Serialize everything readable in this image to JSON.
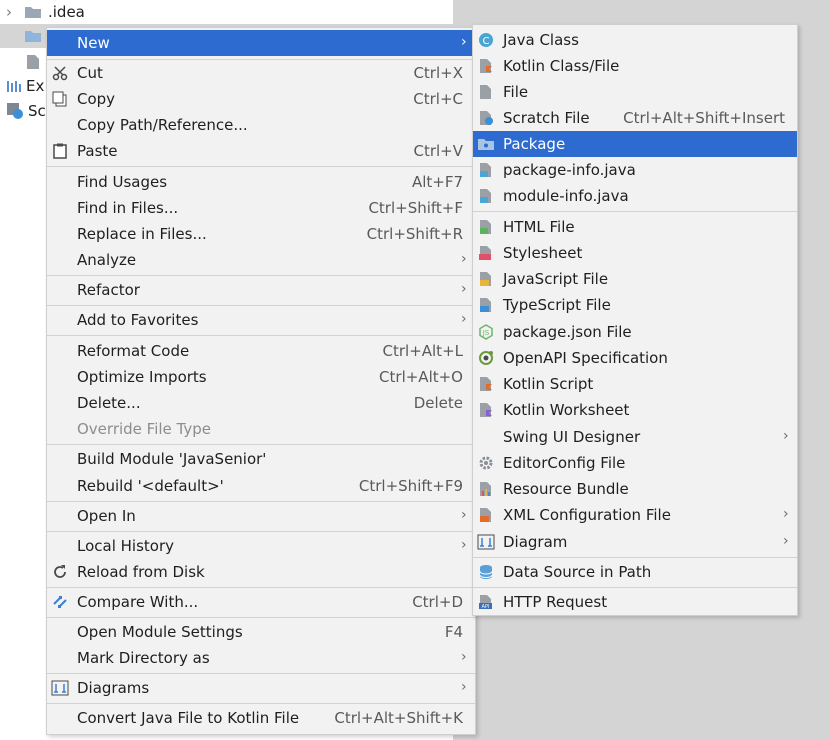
{
  "tree": {
    "rows": [
      ".idea",
      "",
      "Ex",
      "Sc"
    ]
  },
  "main_menu": {
    "items": [
      {
        "label": "New",
        "shortcut": "",
        "submenu": true
      },
      {
        "label": "Cut",
        "shortcut": "Ctrl+X",
        "icon": "scissors-icon"
      },
      {
        "label": "Copy",
        "shortcut": "Ctrl+C",
        "icon": "copy-icon"
      },
      {
        "label": "Copy Path/Reference...",
        "shortcut": ""
      },
      {
        "label": "Paste",
        "shortcut": "Ctrl+V",
        "icon": "clipboard-icon"
      },
      {
        "label": "Find Usages",
        "shortcut": "Alt+F7"
      },
      {
        "label": "Find in Files...",
        "shortcut": "Ctrl+Shift+F"
      },
      {
        "label": "Replace in Files...",
        "shortcut": "Ctrl+Shift+R"
      },
      {
        "label": "Analyze",
        "shortcut": "",
        "submenu": true
      },
      {
        "label": "Refactor",
        "shortcut": "",
        "submenu": true
      },
      {
        "label": "Add to Favorites",
        "shortcut": "",
        "submenu": true
      },
      {
        "label": "Reformat Code",
        "shortcut": "Ctrl+Alt+L"
      },
      {
        "label": "Optimize Imports",
        "shortcut": "Ctrl+Alt+O"
      },
      {
        "label": "Delete...",
        "shortcut": "Delete"
      },
      {
        "label": "Override File Type",
        "shortcut": "",
        "disabled": true
      },
      {
        "label": "Build Module 'JavaSenior'",
        "shortcut": ""
      },
      {
        "label": "Rebuild '<default>'",
        "shortcut": "Ctrl+Shift+F9"
      },
      {
        "label": "Open In",
        "shortcut": "",
        "submenu": true
      },
      {
        "label": "Local History",
        "shortcut": "",
        "submenu": true
      },
      {
        "label": "Reload from Disk",
        "shortcut": "",
        "icon": "reload-icon"
      },
      {
        "label": "Compare With...",
        "shortcut": "Ctrl+D",
        "icon": "compare-icon"
      },
      {
        "label": "Open Module Settings",
        "shortcut": "F4"
      },
      {
        "label": "Mark Directory as",
        "shortcut": "",
        "submenu": true
      },
      {
        "label": "Diagrams",
        "shortcut": "",
        "submenu": true,
        "icon": "diagram-icon"
      },
      {
        "label": "Convert Java File to Kotlin File",
        "shortcut": "Ctrl+Alt+Shift+K"
      }
    ]
  },
  "new_menu": {
    "items": [
      {
        "label": "Java Class",
        "shortcut": "",
        "icon": "java-class-icon"
      },
      {
        "label": "Kotlin Class/File",
        "shortcut": "",
        "icon": "kotlin-file-icon"
      },
      {
        "label": "File",
        "shortcut": "",
        "icon": "file-icon"
      },
      {
        "label": "Scratch File",
        "shortcut": "Ctrl+Alt+Shift+Insert",
        "icon": "scratch-file-icon"
      },
      {
        "label": "Package",
        "shortcut": "",
        "icon": "package-folder-icon"
      },
      {
        "label": "package-info.java",
        "shortcut": "",
        "icon": "java-file-icon"
      },
      {
        "label": "module-info.java",
        "shortcut": "",
        "icon": "java-file-icon"
      },
      {
        "label": "HTML File",
        "shortcut": "",
        "icon": "html-file-icon"
      },
      {
        "label": "Stylesheet",
        "shortcut": "",
        "icon": "css-file-icon"
      },
      {
        "label": "JavaScript File",
        "shortcut": "",
        "icon": "js-file-icon"
      },
      {
        "label": "TypeScript File",
        "shortcut": "",
        "icon": "ts-file-icon"
      },
      {
        "label": "package.json File",
        "shortcut": "",
        "icon": "nodejs-icon"
      },
      {
        "label": "OpenAPI Specification",
        "shortcut": "",
        "icon": "openapi-icon"
      },
      {
        "label": "Kotlin Script",
        "shortcut": "",
        "icon": "kotlin-script-icon"
      },
      {
        "label": "Kotlin Worksheet",
        "shortcut": "",
        "icon": "kotlin-worksheet-icon"
      },
      {
        "label": "Swing UI Designer",
        "shortcut": "",
        "submenu": true
      },
      {
        "label": "EditorConfig File",
        "shortcut": "",
        "icon": "gear-icon"
      },
      {
        "label": "Resource Bundle",
        "shortcut": "",
        "icon": "resource-bundle-icon"
      },
      {
        "label": "XML Configuration File",
        "shortcut": "",
        "submenu": true,
        "icon": "xml-file-icon"
      },
      {
        "label": "Diagram",
        "shortcut": "",
        "submenu": true,
        "icon": "diagram-icon"
      },
      {
        "label": "Data Source in Path",
        "shortcut": "",
        "icon": "database-icon"
      },
      {
        "label": "HTTP Request",
        "shortcut": "",
        "icon": "api-icon"
      }
    ]
  },
  "colors": {
    "highlight": "#2e6bd0",
    "menu_bg": "#f2f2f2",
    "separator": "#d2d2d2",
    "shortcut_text": "#5a5a5a",
    "disabled_text": "#8d8d8d"
  }
}
